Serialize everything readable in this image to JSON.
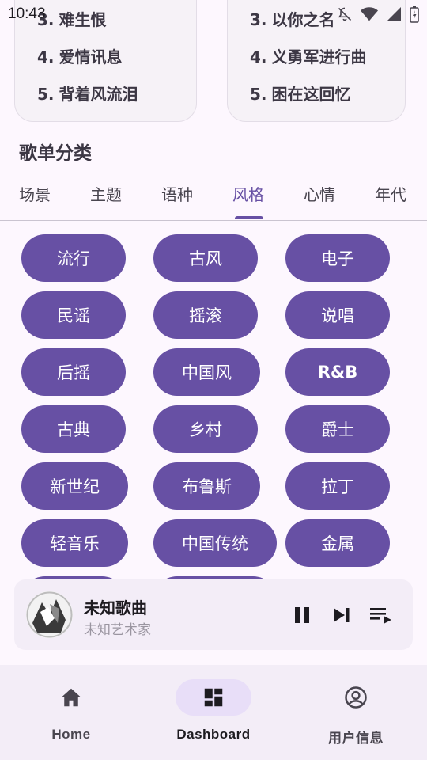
{
  "status_bar": {
    "time": "10:43"
  },
  "rank_left": [
    {
      "num": "3.",
      "title": "难生恨"
    },
    {
      "num": "4.",
      "title": "爱情讯息"
    },
    {
      "num": "5.",
      "title": "背着风流泪"
    }
  ],
  "rank_right": [
    {
      "num": "3.",
      "title": "以你之名"
    },
    {
      "num": "4.",
      "title": "义勇军进行曲"
    },
    {
      "num": "5.",
      "title": "困在这回忆"
    }
  ],
  "section_title": "歌单分类",
  "tabs": [
    "场景",
    "主题",
    "语种",
    "风格",
    "心情",
    "年代"
  ],
  "active_tab": "风格",
  "chips": [
    "流行",
    "古风",
    "电子",
    "民谣",
    "摇滚",
    "说唱",
    "后摇",
    "中国风",
    "R&B",
    "古典",
    "乡村",
    "爵士",
    "新世纪",
    "布鲁斯",
    "拉丁",
    "轻音乐",
    "中国传统",
    "金属"
  ],
  "player": {
    "title": "未知歌曲",
    "artist": "未知艺术家"
  },
  "nav": [
    {
      "label": "Home",
      "icon": "home-icon"
    },
    {
      "label": "Dashboard",
      "icon": "dashboard-icon"
    },
    {
      "label": "用户信息",
      "icon": "account-circle-icon"
    }
  ],
  "colors": {
    "accent": "#6750A4",
    "background": "#FDF7FE",
    "nav_bg": "#F3EDF7"
  }
}
